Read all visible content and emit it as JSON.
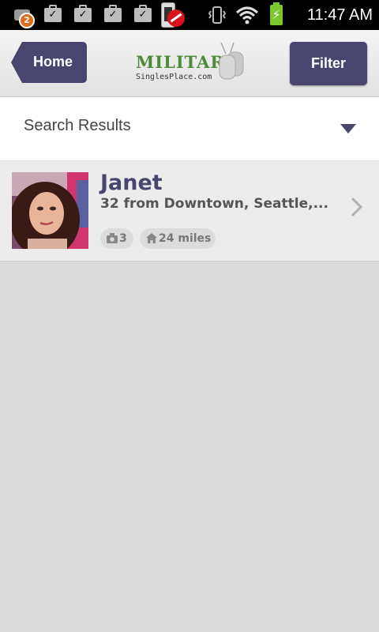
{
  "status_bar": {
    "notification_count": "2",
    "time": "11:47 AM",
    "icons": [
      "notification-icon",
      "clipboard-check-icon",
      "clipboard-check-icon",
      "clipboard-check-icon",
      "clipboard-check-icon",
      "phone-record-icon",
      "vibrate-icon",
      "wifi-icon",
      "battery-charging-icon"
    ]
  },
  "header": {
    "home_label": "Home",
    "filter_label": "Filter",
    "logo_main": "MILITARY",
    "logo_sub": "SinglesPlace.com"
  },
  "search": {
    "label": "Search Results"
  },
  "results": [
    {
      "name": "Janet",
      "subtitle": "32 from Downtown, Seattle,...",
      "photo_count": "3",
      "distance": "24 miles"
    }
  ],
  "colors": {
    "accent": "#48456f",
    "logo_green": "#4d8a3a",
    "background": "#dcdcdc"
  }
}
